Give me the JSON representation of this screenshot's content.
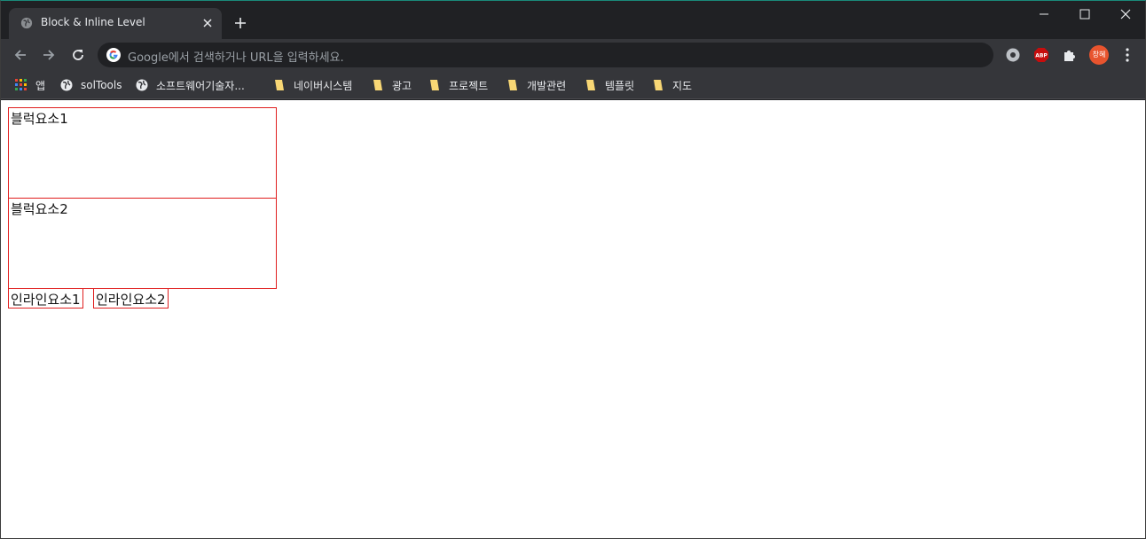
{
  "tab": {
    "title": "Block & Inline Level"
  },
  "omnibox": {
    "placeholder": "Google에서 검색하거나 URL을 입력하세요."
  },
  "profile": {
    "initials": "창혜"
  },
  "extensions": {
    "abp_label": "ABP"
  },
  "bookmarks": [
    {
      "label": "앱",
      "icon": "apps-grid-icon"
    },
    {
      "label": "solTools",
      "icon": "globe-icon"
    },
    {
      "label": "소프트웨어기술자...",
      "icon": "globe-icon"
    },
    {
      "label": "네이버시스템",
      "icon": "folder-icon"
    },
    {
      "label": "광고",
      "icon": "folder-icon"
    },
    {
      "label": "프로젝트",
      "icon": "folder-icon"
    },
    {
      "label": "개발관련",
      "icon": "folder-icon"
    },
    {
      "label": "템플릿",
      "icon": "folder-icon"
    },
    {
      "label": "지도",
      "icon": "folder-icon"
    }
  ],
  "page": {
    "block1": "블럭요소1",
    "block2": "블럭요소2",
    "inline1": "인라인요소1",
    "inline2": "인라인요소2"
  },
  "colors": {
    "border": "#e01e1e",
    "chrome_dark": "#202124",
    "chrome_toolbar": "#35363a"
  }
}
